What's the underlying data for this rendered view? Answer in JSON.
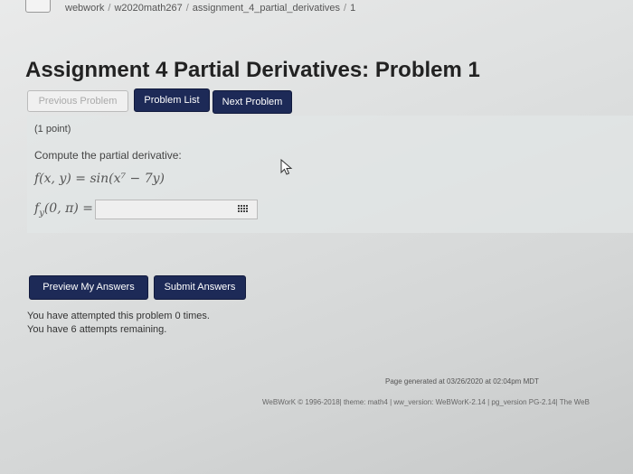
{
  "breadcrumb": {
    "items": [
      "webwork",
      "w2020math267",
      "assignment_4_partial_derivatives",
      "1"
    ],
    "separator": "/"
  },
  "title": "Assignment 4 Partial Derivatives: Problem 1",
  "nav": {
    "previous": "Previous Problem",
    "list": "Problem List",
    "next": "Next Problem"
  },
  "problem": {
    "points": "(1 point)",
    "prompt": "Compute the partial derivative:",
    "function_lhs": "f(x, y) = ",
    "function_rhs": "sin(x⁷ − 7y)",
    "target": "f",
    "target_sub": "y",
    "target_args": "(0, π) = ",
    "answer_value": ""
  },
  "actions": {
    "preview": "Preview My Answers",
    "submit": "Submit Answers"
  },
  "attempts": {
    "line1": "You have attempted this problem 0 times.",
    "line2": "You have 6 attempts remaining."
  },
  "footer": {
    "generated": "Page generated at 03/26/2020 at 02:04pm MDT",
    "credits": "WeBWorK © 1996-2018| theme: math4 | ww_version: WeBWorK-2.14 | pg_version PG-2.14| The WeB"
  },
  "colors": {
    "button_dark": "#1d2a57",
    "background": "#e2e4e4"
  },
  "icons": [
    "equation-editor-icon",
    "mouse-cursor-icon"
  ]
}
